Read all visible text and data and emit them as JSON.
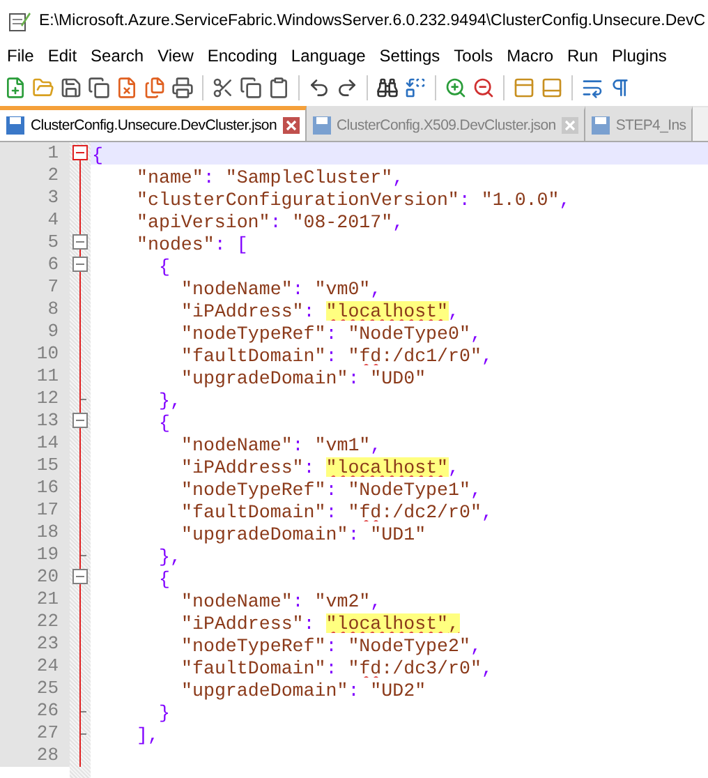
{
  "window": {
    "title": "E:\\Microsoft.Azure.ServiceFabric.WindowsServer.6.0.232.9494\\ClusterConfig.Unsecure.DevC"
  },
  "menu": [
    "File",
    "Edit",
    "Search",
    "View",
    "Encoding",
    "Language",
    "Settings",
    "Tools",
    "Macro",
    "Run",
    "Plugins"
  ],
  "tabs": [
    {
      "label": "ClusterConfig.Unsecure.DevCluster.json",
      "selected": true
    },
    {
      "label": "ClusterConfig.X509.DevCluster.json",
      "selected": false
    },
    {
      "label": "STEP4_Ins",
      "selected": false
    }
  ],
  "editor": {
    "lines": [
      {
        "number": "1",
        "kind": "top",
        "current": true,
        "tokens": [
          {
            "kind": "punct",
            "text": "{"
          }
        ]
      },
      {
        "number": "2",
        "kind": "line",
        "current": false,
        "tokens": [
          {
            "kind": "string",
            "text": "    \"name\""
          },
          {
            "kind": "punct",
            "text": ": "
          },
          {
            "kind": "string",
            "text": "\"SampleCluster\""
          },
          {
            "kind": "punct",
            "text": ","
          }
        ]
      },
      {
        "number": "3",
        "kind": "line",
        "current": false,
        "tokens": [
          {
            "kind": "string",
            "text": "    \"clusterConfigurationVersion\""
          },
          {
            "kind": "punct",
            "text": ": "
          },
          {
            "kind": "string",
            "text": "\"1.0.0\""
          },
          {
            "kind": "punct",
            "text": ","
          }
        ]
      },
      {
        "number": "4",
        "kind": "line",
        "current": false,
        "tokens": [
          {
            "kind": "string",
            "text": "    \"apiVersion\""
          },
          {
            "kind": "punct",
            "text": ": "
          },
          {
            "kind": "string",
            "text": "\"08-2017\""
          },
          {
            "kind": "punct",
            "text": ","
          }
        ]
      },
      {
        "number": "5",
        "kind": "box",
        "current": false,
        "tokens": [
          {
            "kind": "string",
            "text": "    \"nodes\""
          },
          {
            "kind": "punct",
            "text": ": ["
          }
        ]
      },
      {
        "number": "6",
        "kind": "box",
        "current": false,
        "tokens": [
          {
            "kind": "punct",
            "text": "      {"
          }
        ]
      },
      {
        "number": "7",
        "kind": "line",
        "current": false,
        "tokens": [
          {
            "kind": "string",
            "text": "        \"nodeName\""
          },
          {
            "kind": "punct",
            "text": ": "
          },
          {
            "kind": "string",
            "text": "\"vm0\""
          },
          {
            "kind": "punct",
            "text": ","
          }
        ]
      },
      {
        "number": "8",
        "kind": "line",
        "current": false,
        "tokens": [
          {
            "kind": "string",
            "text": "        \"iPAddress\""
          },
          {
            "kind": "punct",
            "text": ": "
          },
          {
            "kind": "mark",
            "text": "\"localhost\""
          },
          {
            "kind": "punct",
            "text": ","
          }
        ]
      },
      {
        "number": "9",
        "kind": "line",
        "current": false,
        "tokens": [
          {
            "kind": "string",
            "text": "        \"nodeTypeRef\""
          },
          {
            "kind": "punct",
            "text": ": "
          },
          {
            "kind": "string",
            "text": "\"NodeType0\""
          },
          {
            "kind": "punct",
            "text": ","
          }
        ]
      },
      {
        "number": "10",
        "kind": "line",
        "current": false,
        "tokens": [
          {
            "kind": "string",
            "text": "        \"faultDomain\""
          },
          {
            "kind": "punct",
            "text": ": "
          },
          {
            "kind": "string",
            "text": "\""
          },
          {
            "kind": "typo",
            "text": "fd"
          },
          {
            "kind": "string",
            "text": ":/dc1/r0\""
          },
          {
            "kind": "punct",
            "text": ","
          }
        ]
      },
      {
        "number": "11",
        "kind": "line",
        "current": false,
        "tokens": [
          {
            "kind": "string",
            "text": "        \"upgradeDomain\""
          },
          {
            "kind": "punct",
            "text": ": "
          },
          {
            "kind": "string",
            "text": "\"UD0\""
          }
        ]
      },
      {
        "number": "12",
        "kind": "end",
        "current": false,
        "tokens": [
          {
            "kind": "punct",
            "text": "      },"
          }
        ]
      },
      {
        "number": "13",
        "kind": "box",
        "current": false,
        "tokens": [
          {
            "kind": "punct",
            "text": "      {"
          }
        ]
      },
      {
        "number": "14",
        "kind": "line",
        "current": false,
        "tokens": [
          {
            "kind": "string",
            "text": "        \"nodeName\""
          },
          {
            "kind": "punct",
            "text": ": "
          },
          {
            "kind": "string",
            "text": "\"vm1\""
          },
          {
            "kind": "punct",
            "text": ","
          }
        ]
      },
      {
        "number": "15",
        "kind": "line",
        "current": false,
        "tokens": [
          {
            "kind": "string",
            "text": "        \"iPAddress\""
          },
          {
            "kind": "punct",
            "text": ": "
          },
          {
            "kind": "mark",
            "text": "\"localhost\""
          },
          {
            "kind": "punct",
            "text": ","
          }
        ]
      },
      {
        "number": "16",
        "kind": "line",
        "current": false,
        "tokens": [
          {
            "kind": "string",
            "text": "        \"nodeTypeRef\""
          },
          {
            "kind": "punct",
            "text": ": "
          },
          {
            "kind": "string",
            "text": "\"NodeType1\""
          },
          {
            "kind": "punct",
            "text": ","
          }
        ]
      },
      {
        "number": "17",
        "kind": "line",
        "current": false,
        "tokens": [
          {
            "kind": "string",
            "text": "        \"faultDomain\""
          },
          {
            "kind": "punct",
            "text": ": "
          },
          {
            "kind": "string",
            "text": "\""
          },
          {
            "kind": "typo",
            "text": "fd"
          },
          {
            "kind": "string",
            "text": ":/dc2/r0\""
          },
          {
            "kind": "punct",
            "text": ","
          }
        ]
      },
      {
        "number": "18",
        "kind": "line",
        "current": false,
        "tokens": [
          {
            "kind": "string",
            "text": "        \"upgradeDomain\""
          },
          {
            "kind": "punct",
            "text": ": "
          },
          {
            "kind": "string",
            "text": "\"UD1\""
          }
        ]
      },
      {
        "number": "19",
        "kind": "end",
        "current": false,
        "tokens": [
          {
            "kind": "punct",
            "text": "      },"
          }
        ]
      },
      {
        "number": "20",
        "kind": "box",
        "current": false,
        "tokens": [
          {
            "kind": "punct",
            "text": "      {"
          }
        ]
      },
      {
        "number": "21",
        "kind": "line",
        "current": false,
        "tokens": [
          {
            "kind": "string",
            "text": "        \"nodeName\""
          },
          {
            "kind": "punct",
            "text": ": "
          },
          {
            "kind": "string",
            "text": "\"vm2\""
          },
          {
            "kind": "punct",
            "text": ","
          }
        ]
      },
      {
        "number": "22",
        "kind": "line",
        "current": false,
        "tokens": [
          {
            "kind": "string",
            "text": "        \"iPAddress\""
          },
          {
            "kind": "punct",
            "text": ": "
          },
          {
            "kind": "mark",
            "text": "\"localhost\","
          }
        ]
      },
      {
        "number": "23",
        "kind": "line",
        "current": false,
        "tokens": [
          {
            "kind": "string",
            "text": "        \"nodeTypeRef\""
          },
          {
            "kind": "punct",
            "text": ": "
          },
          {
            "kind": "string",
            "text": "\"NodeType2\""
          },
          {
            "kind": "punct",
            "text": ","
          }
        ]
      },
      {
        "number": "24",
        "kind": "line",
        "current": false,
        "tokens": [
          {
            "kind": "string",
            "text": "        \"faultDomain\""
          },
          {
            "kind": "punct",
            "text": ": "
          },
          {
            "kind": "string",
            "text": "\""
          },
          {
            "kind": "typo",
            "text": "fd"
          },
          {
            "kind": "string",
            "text": ":/dc3/r0\""
          },
          {
            "kind": "punct",
            "text": ","
          }
        ]
      },
      {
        "number": "25",
        "kind": "line",
        "current": false,
        "tokens": [
          {
            "kind": "string",
            "text": "        \"upgradeDomain\""
          },
          {
            "kind": "punct",
            "text": ": "
          },
          {
            "kind": "string",
            "text": "\"UD2\""
          }
        ]
      },
      {
        "number": "26",
        "kind": "end",
        "current": false,
        "tokens": [
          {
            "kind": "punct",
            "text": "      }"
          }
        ]
      },
      {
        "number": "27",
        "kind": "end",
        "current": false,
        "tokens": [
          {
            "kind": "punct",
            "text": "    ],"
          }
        ]
      },
      {
        "number": "28",
        "kind": "line",
        "current": false
      }
    ]
  }
}
